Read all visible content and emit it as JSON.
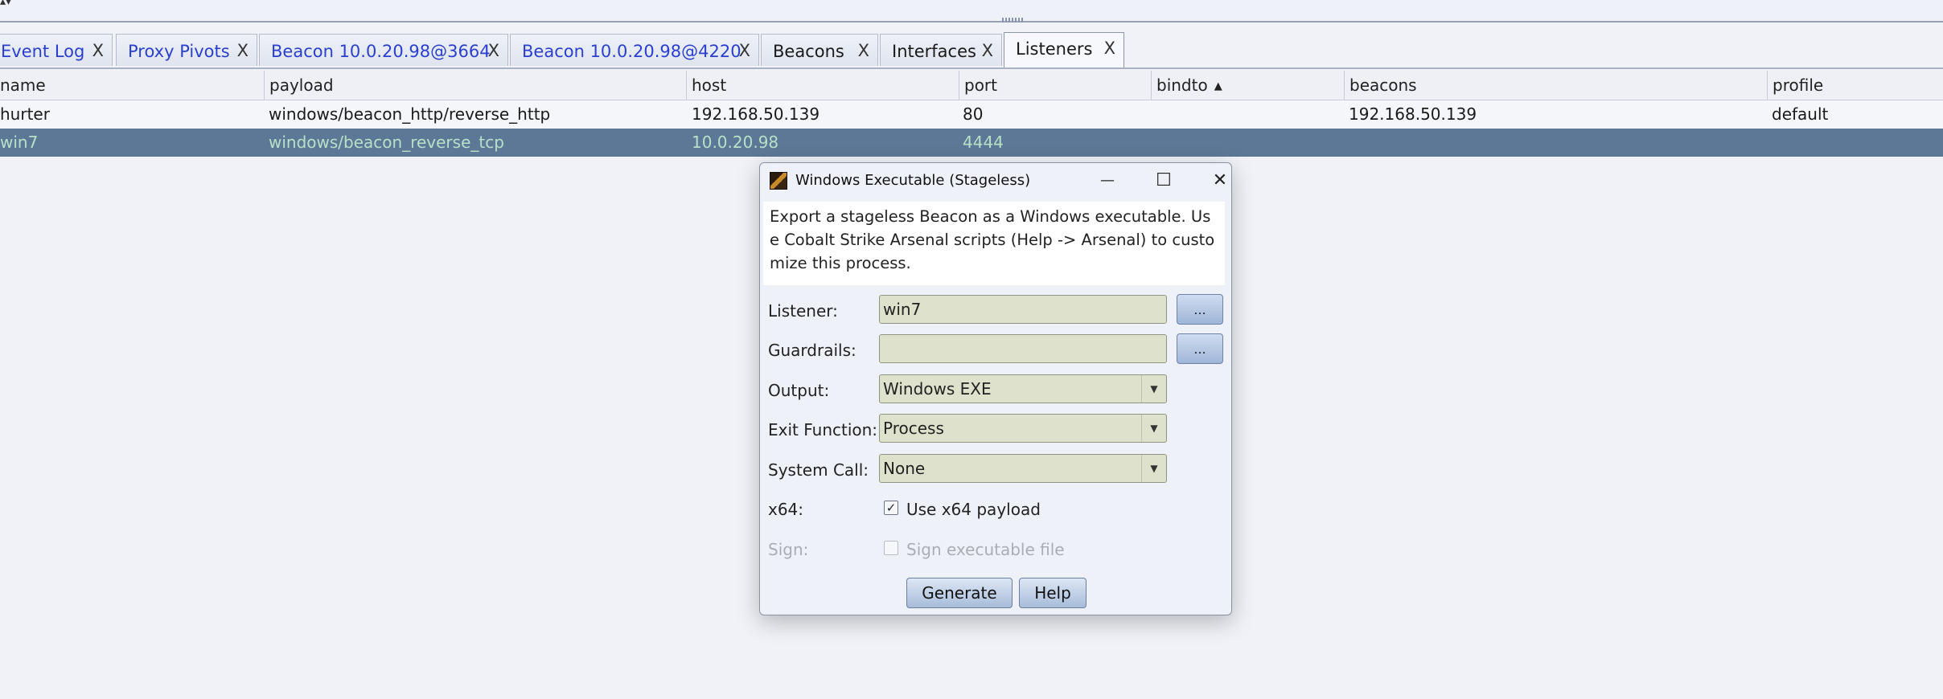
{
  "tabs": [
    {
      "label": "Event Log",
      "close": "X"
    },
    {
      "label": "Proxy Pivots",
      "close": "X"
    },
    {
      "label": "Beacon 10.0.20.98@3664",
      "close": "X"
    },
    {
      "label": "Beacon 10.0.20.98@4220",
      "close": "X"
    },
    {
      "label": "Beacons",
      "close": "X"
    },
    {
      "label": "Interfaces",
      "close": "X"
    },
    {
      "label": "Listeners",
      "close": "X"
    }
  ],
  "table": {
    "columns": [
      "name",
      "payload",
      "host",
      "port",
      "bindto",
      "beacons",
      "profile"
    ],
    "sorted_column": "bindto",
    "rows": [
      {
        "name": "hurter",
        "payload": "windows/beacon_http/reverse_http",
        "host": "192.168.50.139",
        "port": "80",
        "bindto": "",
        "beacons": "192.168.50.139",
        "profile": "default"
      },
      {
        "name": "win7",
        "payload": "windows/beacon_reverse_tcp",
        "host": "10.0.20.98",
        "port": "4444",
        "bindto": "",
        "beacons": "",
        "profile": ""
      }
    ]
  },
  "dialog": {
    "title": "Windows Executable (Stageless)",
    "description": "Export a stageless Beacon as a Windows executable. Use Cobalt Strike Arsenal scripts (Help -> Arsenal) to customize this process.",
    "fields": {
      "listener": {
        "label": "Listener:",
        "value": "win7",
        "button": "..."
      },
      "guardrails": {
        "label": "Guardrails:",
        "value": "",
        "button": "..."
      },
      "output": {
        "label": "Output:",
        "value": "Windows EXE"
      },
      "exit_function": {
        "label": "Exit Function:",
        "value": "Process"
      },
      "system_call": {
        "label": "System Call:",
        "value": "None"
      },
      "x64": {
        "label": "x64:",
        "checkbox_label": "Use x64 payload",
        "checked": true
      },
      "sign": {
        "label": "Sign:",
        "checkbox_label": "Sign executable file",
        "checked": false,
        "enabled": false
      }
    },
    "buttons": {
      "generate": "Generate",
      "help": "Help"
    },
    "window_controls": {
      "minimize": "—",
      "maximize": "☐",
      "close": "✕"
    }
  },
  "icons": {
    "dialog_app": "cobalt-strike-icon",
    "sort": "sort-ascending-icon",
    "combo": "chevron-down-icon",
    "check": "checkmark-icon"
  },
  "colors": {
    "selected_row": "#5d7896",
    "selected_row_text": "#b8e0c8",
    "tab_text": "#2a3fd0",
    "field_bg": "#dee2cc"
  }
}
